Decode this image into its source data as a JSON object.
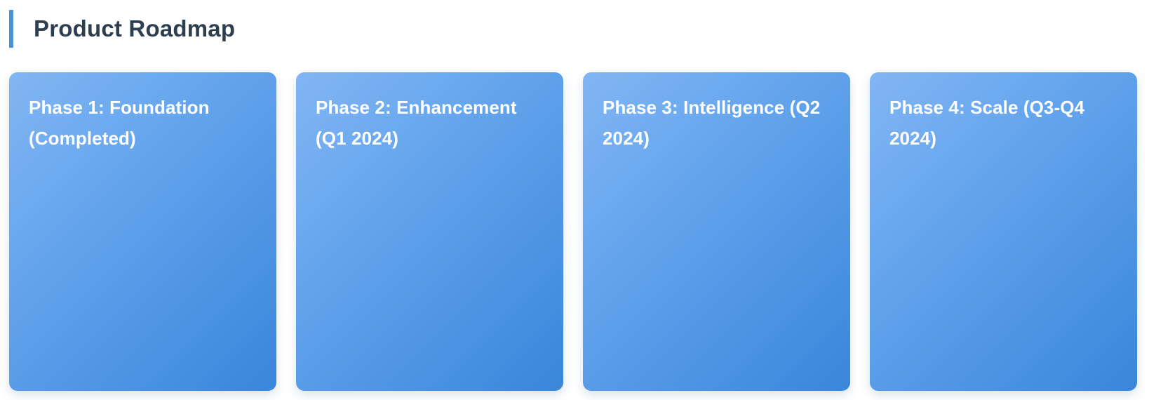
{
  "header": {
    "title": "Product Roadmap"
  },
  "colors": {
    "accent": "#4a90d9",
    "title_text": "#2c3e50",
    "card_gradient_start": "#82b6f4",
    "card_gradient_end": "#3a86db"
  },
  "phases": [
    {
      "title": "Phase 1: Foundation (Completed)"
    },
    {
      "title": "Phase 2: Enhancement (Q1 2024)"
    },
    {
      "title": "Phase 3: Intelligence (Q2 2024)"
    },
    {
      "title": "Phase 4: Scale (Q3-Q4 2024)"
    }
  ]
}
